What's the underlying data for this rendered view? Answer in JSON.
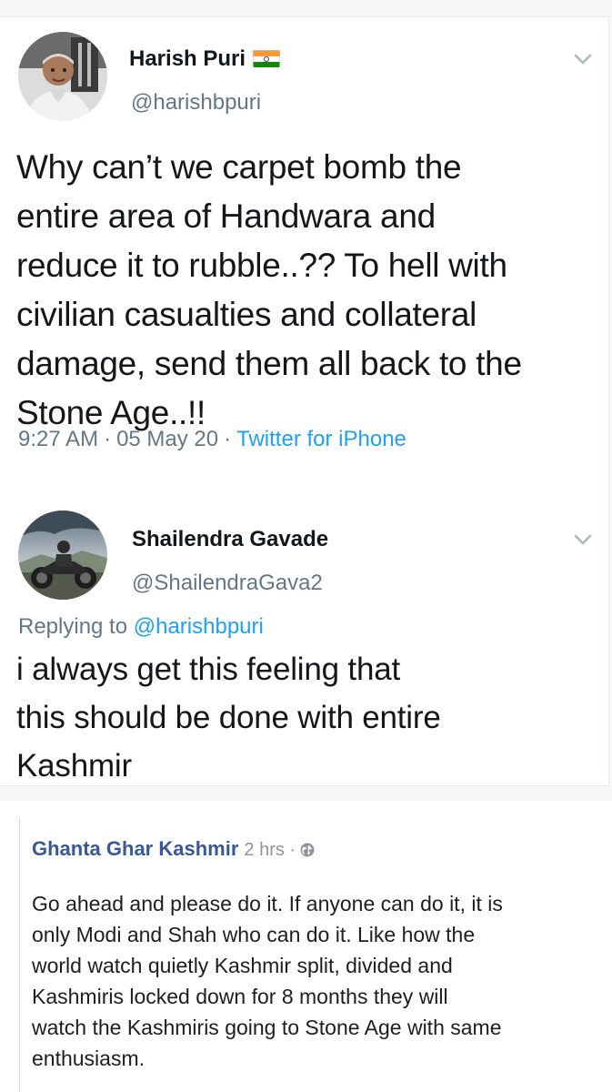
{
  "tweet": {
    "author": {
      "name": "Harish Puri",
      "handle": "@harishbpuri",
      "flag_icon": "india-flag-icon"
    },
    "text": "Why can’t we carpet bomb the\nentire area of Handwara and\nreduce it to rubble..?? To hell with\ncivilian casualties and collateral\ndamage, send them all back to the\nStone Age..!!",
    "time": "9:27 AM",
    "separator": "·",
    "date": "05 May 20",
    "source": "Twitter for iPhone",
    "menu_icon": "chevron-down-icon"
  },
  "reply": {
    "author": {
      "name": "Shailendra Gavade",
      "handle": "@ShailendraGava2"
    },
    "replying_prefix": "Replying to",
    "replying_to": "@harishbpuri",
    "text": "i always get this feeling that\nthis should be done with entire\nKashmir",
    "menu_icon": "chevron-down-icon"
  },
  "comment": {
    "author": "Ghanta Ghar Kashmir",
    "time": "2 hrs",
    "separator": "·",
    "privacy_icon": "globe-icon",
    "text": "Go ahead and please do it. If anyone can do it, it is\nonly Modi and Shah who can do it. Like how the\nworld watch quietly Kashmir split, divided and\nKashmiris locked down for 8 months they will\nwatch the Kashmiris going to Stone Age with same\nenthusiasm."
  },
  "colors": {
    "twitter_blue": "#1da1f2",
    "text_primary": "#14171a",
    "text_secondary": "#657786",
    "facebook_link": "#385898"
  }
}
